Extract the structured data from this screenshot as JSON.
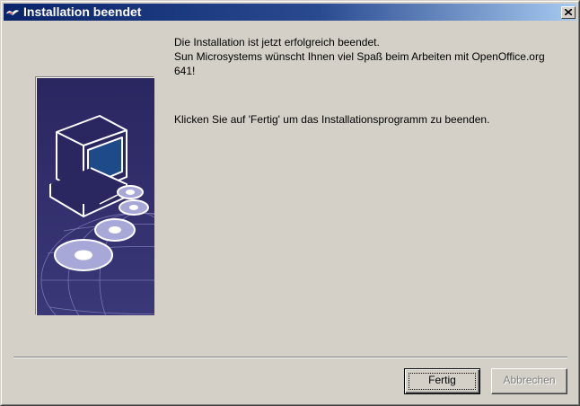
{
  "window": {
    "title": "Installation beendet"
  },
  "message": {
    "line1": "Die Installation ist jetzt erfolgreich beendet.",
    "line2": "Sun Microsystems wünscht Ihnen viel Spaß beim Arbeiten mit OpenOffice.org",
    "line3": "641!",
    "instruction": "Klicken Sie auf 'Fertig' um das Installationsprogramm zu beenden."
  },
  "buttons": {
    "finish_label": "Fertig",
    "cancel_label": "Abbrechen"
  },
  "colors": {
    "titlebar_start": "#0a246a",
    "titlebar_end": "#a6caf0",
    "banner_background": "#2a2660"
  },
  "icons": {
    "title": "openoffice-gull-icon",
    "close": "close-icon",
    "banner": "computer-with-discs-illustration"
  }
}
